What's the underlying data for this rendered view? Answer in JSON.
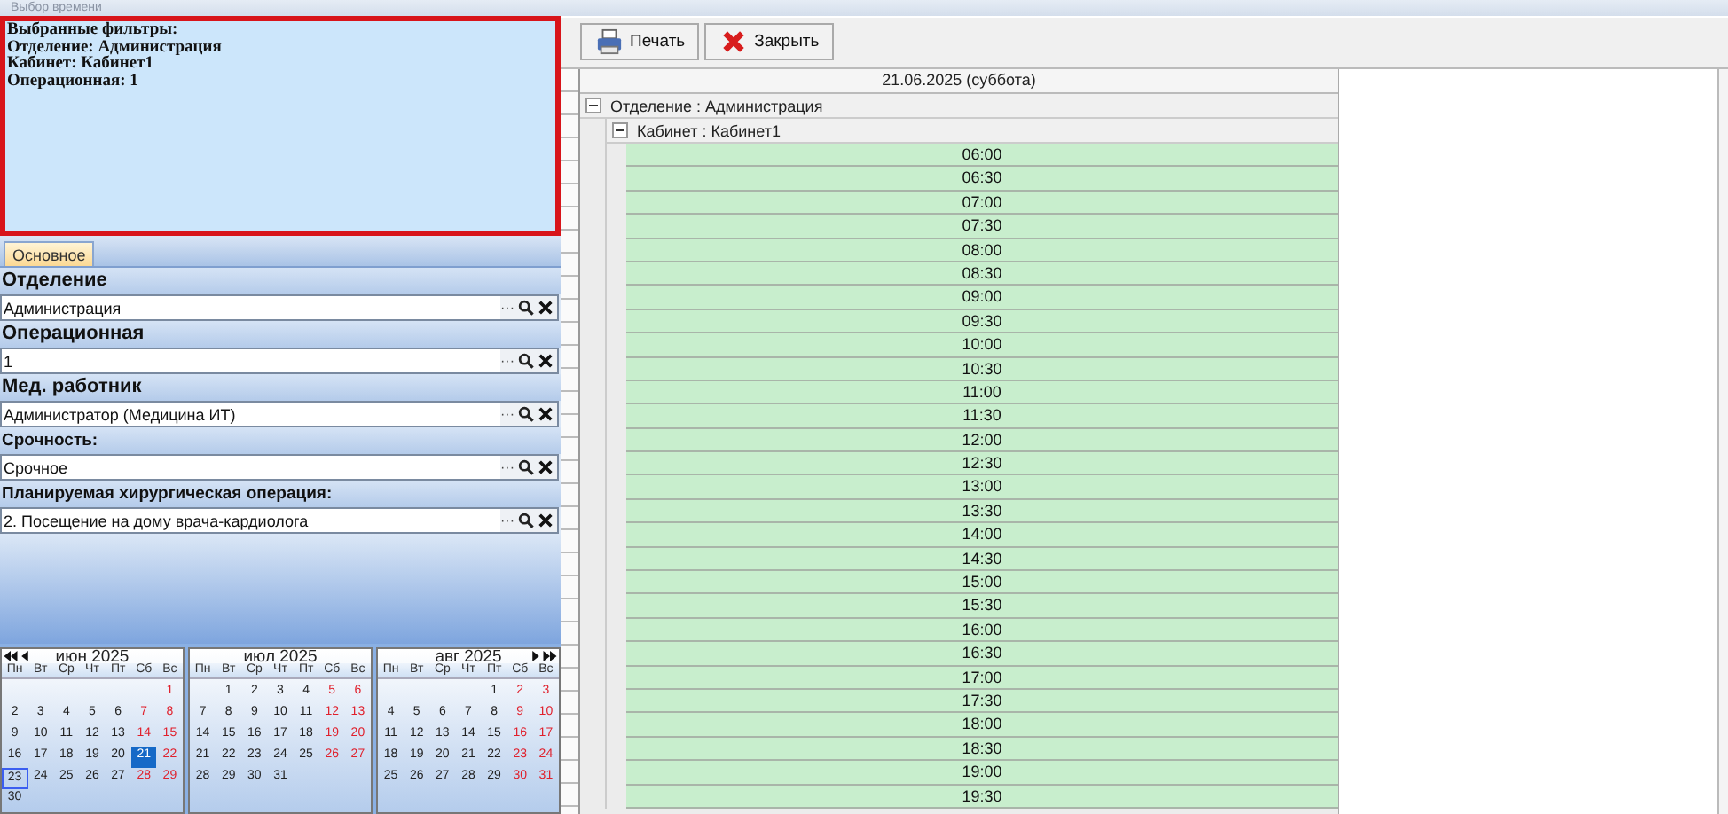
{
  "window": {
    "title": "Выбор времени"
  },
  "filters_summary": {
    "lines": [
      "Выбранные фильтры:",
      "Отделение: Администрация",
      "Кабинет: Кабинет1",
      "Операционная: 1"
    ]
  },
  "tabs": [
    {
      "label": "Основное",
      "selected": true
    }
  ],
  "fields": [
    {
      "kind": "major",
      "label": "Отделение",
      "value": "Администрация",
      "more_button": "···"
    },
    {
      "kind": "major",
      "label": "Операционная",
      "value": "1",
      "more_button": "···"
    },
    {
      "kind": "major",
      "label": "Мед. работник",
      "value": "Администратор (Медицина ИТ)",
      "more_button": "···"
    },
    {
      "kind": "minor",
      "label": "Срочность:",
      "value": "Срочное",
      "more_button": "···"
    },
    {
      "kind": "minor",
      "label": "Планируемая хирургическая операция:",
      "value": "2. Посещение на дому врача-кардиолога",
      "more_button": "···"
    }
  ],
  "calendar": {
    "months": [
      {
        "title": "июн 2025",
        "weekdays": [
          "Пн",
          "Вт",
          "Ср",
          "Чт",
          "Пт",
          "Сб",
          "Вс"
        ],
        "weeks": [
          {
            "right_aligned": true,
            "days": [
              {
                "d": "1",
                "selected": false,
                "today": false
              }
            ]
          },
          {
            "days": [
              {
                "d": "2",
                "selected": false,
                "today": false
              },
              {
                "d": "3",
                "selected": false,
                "today": false
              },
              {
                "d": "4",
                "selected": false,
                "today": false
              },
              {
                "d": "5",
                "selected": false,
                "today": false
              },
              {
                "d": "6",
                "selected": false,
                "today": false
              },
              {
                "d": "7",
                "selected": false,
                "today": false
              },
              {
                "d": "8",
                "selected": false,
                "today": false
              }
            ]
          },
          {
            "days": [
              {
                "d": "9",
                "selected": false,
                "today": false
              },
              {
                "d": "10",
                "selected": false,
                "today": false
              },
              {
                "d": "11",
                "selected": false,
                "today": false
              },
              {
                "d": "12",
                "selected": false,
                "today": false
              },
              {
                "d": "13",
                "selected": false,
                "today": false
              },
              {
                "d": "14",
                "selected": false,
                "today": false
              },
              {
                "d": "15",
                "selected": false,
                "today": false
              }
            ]
          },
          {
            "days": [
              {
                "d": "16",
                "selected": false,
                "today": false
              },
              {
                "d": "17",
                "selected": false,
                "today": false
              },
              {
                "d": "18",
                "selected": false,
                "today": false
              },
              {
                "d": "19",
                "selected": false,
                "today": false
              },
              {
                "d": "20",
                "selected": false,
                "today": false
              },
              {
                "d": "21",
                "selected": true,
                "today": false
              },
              {
                "d": "22",
                "selected": false,
                "today": false
              }
            ]
          },
          {
            "days": [
              {
                "d": "23",
                "selected": false,
                "today": true
              },
              {
                "d": "24",
                "selected": false,
                "today": false
              },
              {
                "d": "25",
                "selected": false,
                "today": false
              },
              {
                "d": "26",
                "selected": false,
                "today": false
              },
              {
                "d": "27",
                "selected": false,
                "today": false
              },
              {
                "d": "28",
                "selected": false,
                "today": false
              },
              {
                "d": "29",
                "selected": false,
                "today": false
              }
            ]
          },
          {
            "right_aligned": false,
            "days": [
              {
                "d": "30",
                "selected": false,
                "today": false
              }
            ]
          }
        ]
      },
      {
        "title": "июл 2025",
        "weekdays": [
          "Пн",
          "Вт",
          "Ср",
          "Чт",
          "Пт",
          "Сб",
          "Вс"
        ],
        "weeks": [
          {
            "right_aligned": true,
            "days": [
              {
                "d": "1",
                "selected": false,
                "today": false
              },
              {
                "d": "2",
                "selected": false,
                "today": false
              },
              {
                "d": "3",
                "selected": false,
                "today": false
              },
              {
                "d": "4",
                "selected": false,
                "today": false
              },
              {
                "d": "5",
                "selected": false,
                "today": false
              },
              {
                "d": "6",
                "selected": false,
                "today": false
              }
            ]
          },
          {
            "days": [
              {
                "d": "7",
                "selected": false,
                "today": false
              },
              {
                "d": "8",
                "selected": false,
                "today": false
              },
              {
                "d": "9",
                "selected": false,
                "today": false
              },
              {
                "d": "10",
                "selected": false,
                "today": false
              },
              {
                "d": "11",
                "selected": false,
                "today": false
              },
              {
                "d": "12",
                "selected": false,
                "today": false
              },
              {
                "d": "13",
                "selected": false,
                "today": false
              }
            ]
          },
          {
            "days": [
              {
                "d": "14",
                "selected": false,
                "today": false
              },
              {
                "d": "15",
                "selected": false,
                "today": false
              },
              {
                "d": "16",
                "selected": false,
                "today": false
              },
              {
                "d": "17",
                "selected": false,
                "today": false
              },
              {
                "d": "18",
                "selected": false,
                "today": false
              },
              {
                "d": "19",
                "selected": false,
                "today": false
              },
              {
                "d": "20",
                "selected": false,
                "today": false
              }
            ]
          },
          {
            "days": [
              {
                "d": "21",
                "selected": false,
                "today": false
              },
              {
                "d": "22",
                "selected": false,
                "today": false
              },
              {
                "d": "23",
                "selected": false,
                "today": false
              },
              {
                "d": "24",
                "selected": false,
                "today": false
              },
              {
                "d": "25",
                "selected": false,
                "today": false
              },
              {
                "d": "26",
                "selected": false,
                "today": false
              },
              {
                "d": "27",
                "selected": false,
                "today": false
              }
            ]
          },
          {
            "right_aligned": false,
            "days": [
              {
                "d": "28",
                "selected": false,
                "today": false
              },
              {
                "d": "29",
                "selected": false,
                "today": false
              },
              {
                "d": "30",
                "selected": false,
                "today": false
              },
              {
                "d": "31",
                "selected": false,
                "today": false
              }
            ]
          }
        ]
      },
      {
        "title": "авг 2025",
        "weekdays": [
          "Пн",
          "Вт",
          "Ср",
          "Чт",
          "Пт",
          "Сб",
          "Вс"
        ],
        "weeks": [
          {
            "right_aligned": true,
            "days": [
              {
                "d": "1",
                "selected": false,
                "today": false
              },
              {
                "d": "2",
                "selected": false,
                "today": false
              },
              {
                "d": "3",
                "selected": false,
                "today": false
              }
            ]
          },
          {
            "days": [
              {
                "d": "4",
                "selected": false,
                "today": false
              },
              {
                "d": "5",
                "selected": false,
                "today": false
              },
              {
                "d": "6",
                "selected": false,
                "today": false
              },
              {
                "d": "7",
                "selected": false,
                "today": false
              },
              {
                "d": "8",
                "selected": false,
                "today": false
              },
              {
                "d": "9",
                "selected": false,
                "today": false
              },
              {
                "d": "10",
                "selected": false,
                "today": false
              }
            ]
          },
          {
            "days": [
              {
                "d": "11",
                "selected": false,
                "today": false
              },
              {
                "d": "12",
                "selected": false,
                "today": false
              },
              {
                "d": "13",
                "selected": false,
                "today": false
              },
              {
                "d": "14",
                "selected": false,
                "today": false
              },
              {
                "d": "15",
                "selected": false,
                "today": false
              },
              {
                "d": "16",
                "selected": false,
                "today": false
              },
              {
                "d": "17",
                "selected": false,
                "today": false
              }
            ]
          },
          {
            "days": [
              {
                "d": "18",
                "selected": false,
                "today": false
              },
              {
                "d": "19",
                "selected": false,
                "today": false
              },
              {
                "d": "20",
                "selected": false,
                "today": false
              },
              {
                "d": "21",
                "selected": false,
                "today": false
              },
              {
                "d": "22",
                "selected": false,
                "today": false
              },
              {
                "d": "23",
                "selected": false,
                "today": false
              },
              {
                "d": "24",
                "selected": false,
                "today": false
              }
            ]
          },
          {
            "days": [
              {
                "d": "25",
                "selected": false,
                "today": false
              },
              {
                "d": "26",
                "selected": false,
                "today": false
              },
              {
                "d": "27",
                "selected": false,
                "today": false
              },
              {
                "d": "28",
                "selected": false,
                "today": false
              },
              {
                "d": "29",
                "selected": false,
                "today": false
              },
              {
                "d": "30",
                "selected": false,
                "today": false
              },
              {
                "d": "31",
                "selected": false,
                "today": false
              }
            ]
          }
        ]
      }
    ]
  },
  "toolbar": {
    "buttons": [
      {
        "kind": "print",
        "label": "Печать"
      },
      {
        "kind": "close",
        "label": "Закрыть"
      }
    ]
  },
  "schedule": {
    "date_header": "21.06.2025 (суббота)",
    "groups": [
      {
        "label": "Отделение : Администрация",
        "expanded": true,
        "children": [
          {
            "label": "Кабинет : Кабинет1",
            "expanded": true,
            "slots": [
              "06:00",
              "06:30",
              "07:00",
              "07:30",
              "08:00",
              "08:30",
              "09:00",
              "09:30",
              "10:00",
              "10:30",
              "11:00",
              "11:30",
              "12:00",
              "12:30",
              "13:00",
              "13:30",
              "14:00",
              "14:30",
              "15:00",
              "15:30",
              "16:00",
              "16:30",
              "17:00",
              "17:30",
              "18:00",
              "18:30",
              "19:00",
              "19:30"
            ]
          }
        ]
      }
    ]
  }
}
